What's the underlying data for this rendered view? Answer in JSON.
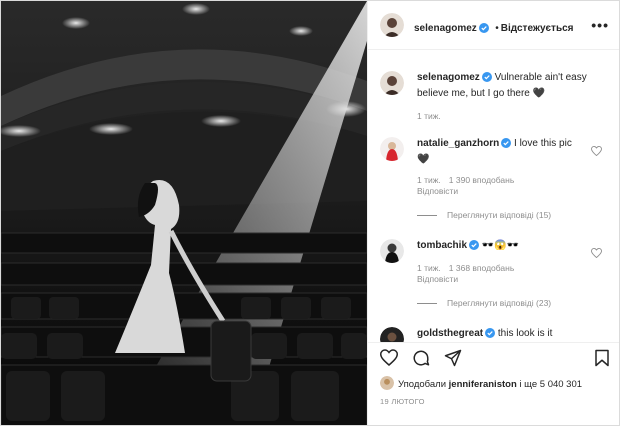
{
  "post": {
    "author": "selenagomez",
    "follow_label": "Відстежується",
    "more_label": "•••",
    "caption": "Vulnerable ain't easy believe me, but I go there 🖤",
    "caption_time": "1 тиж."
  },
  "comments": [
    {
      "user": "natalie_ganzhorn",
      "text": "I love this pic 🖤",
      "time": "1 тиж.",
      "likes": "1 390 вподобань",
      "reply": "Відповісти",
      "view_replies": "Переглянути відповіді (15)"
    },
    {
      "user": "tombachik",
      "text": "🕶️😱🕶️",
      "time": "1 тиж.",
      "likes": "1 368 вподобань",
      "reply": "Відповісти",
      "view_replies": "Переглянути відповіді (23)"
    },
    {
      "user": "goldsthegreat",
      "text": "this look is it"
    }
  ],
  "liked_by": {
    "prefix": "Уподобали",
    "user": "jenniferaniston",
    "suffix": "і ще 5 040 301"
  },
  "date": "19 ЛЮТОГО",
  "colors": {
    "verified": "#3897f0",
    "muted": "#8e8e8e",
    "text": "#262626",
    "border": "#dbdbdb"
  },
  "icons": [
    "more-icon",
    "verified-icon",
    "heart-icon",
    "comment-icon",
    "share-icon",
    "bookmark-icon"
  ]
}
